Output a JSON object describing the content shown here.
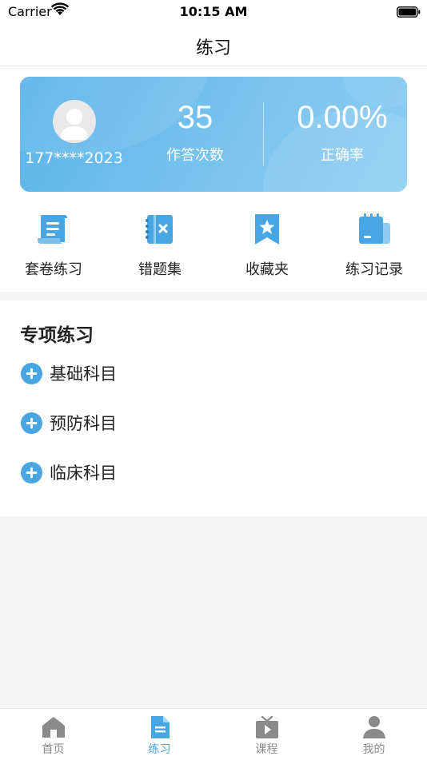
{
  "status_bar": {
    "carrier": "Carrier",
    "time": "10:15 AM"
  },
  "nav": {
    "title": "练习"
  },
  "stats": {
    "phone": "177****2023",
    "count_value": "35",
    "count_label": "作答次数",
    "rate_value": "0.00%",
    "rate_label": "正确率"
  },
  "quick_actions": [
    {
      "label": "套卷练习",
      "icon": "paper-scroll-icon"
    },
    {
      "label": "错题集",
      "icon": "error-notebook-icon"
    },
    {
      "label": "收藏夹",
      "icon": "bookmark-star-icon"
    },
    {
      "label": "练习记录",
      "icon": "notepad-record-icon"
    }
  ],
  "special": {
    "title": "专项练习",
    "items": [
      {
        "label": "基础科目"
      },
      {
        "label": "预防科目"
      },
      {
        "label": "临床科目"
      }
    ]
  },
  "tabs": [
    {
      "label": "首页",
      "icon": "home-icon"
    },
    {
      "label": "练习",
      "icon": "document-icon"
    },
    {
      "label": "课程",
      "icon": "tv-play-icon"
    },
    {
      "label": "我的",
      "icon": "person-icon"
    }
  ],
  "colors": {
    "accent": "#4aa6e2",
    "card_start": "#5ab4ea",
    "card_end": "#8ccdf1",
    "inactive": "#8a8a8a"
  }
}
